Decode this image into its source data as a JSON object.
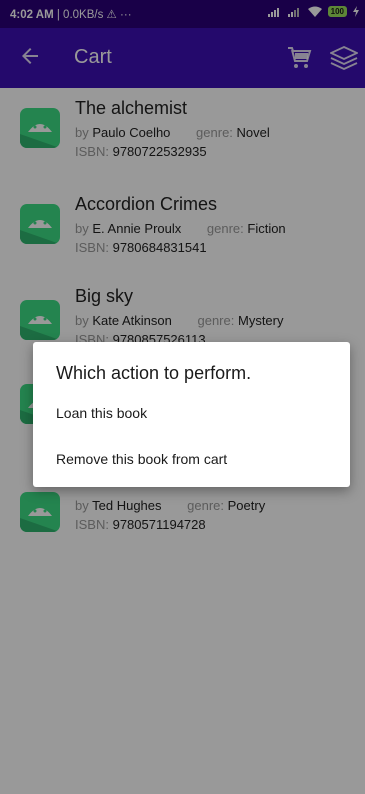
{
  "status_bar": {
    "time": "4:02 AM",
    "network_speed": "| 0.0KB/s",
    "extra": "⚠ ···",
    "battery": "100"
  },
  "app_bar": {
    "title": "Cart",
    "icons": [
      "back-arrow-icon",
      "cart-icon",
      "stack-icon"
    ]
  },
  "labels": {
    "by": "by",
    "genre": "genre:",
    "isbn": "ISBN:"
  },
  "books": [
    {
      "title": "The alchemist",
      "author": "Paulo Coelho",
      "genre": "Novel",
      "isbn": "9780722532935"
    },
    {
      "title": "Accordion Crimes",
      "author": "E. Annie Proulx",
      "genre": "Fiction",
      "isbn": "9780684831541"
    },
    {
      "title": "Big sky",
      "author": "Kate Atkinson",
      "genre": "Mystery",
      "isbn": "9780857526113"
    },
    {
      "title": "",
      "author": "Ted Hughes",
      "genre": "Poetry",
      "isbn": "9780571194728"
    }
  ],
  "dialog": {
    "title": "Which action to perform.",
    "options": [
      "Loan this book",
      "Remove this book from cart"
    ]
  },
  "colors": {
    "status_bar": "#2a0078",
    "app_bar": "#3c0fb4",
    "android_icon": "#3ddc84"
  }
}
